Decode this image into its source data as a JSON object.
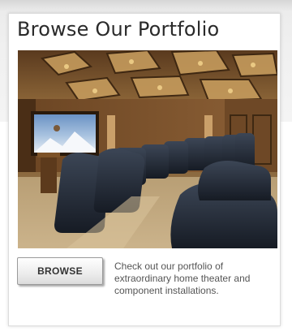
{
  "portfolio": {
    "title": "Browse Our Portfolio",
    "image_icon": "home-theater-photo",
    "browse_label": "BROWSE",
    "description": "Check out our portfolio of extraordinary home theater and component installations."
  }
}
